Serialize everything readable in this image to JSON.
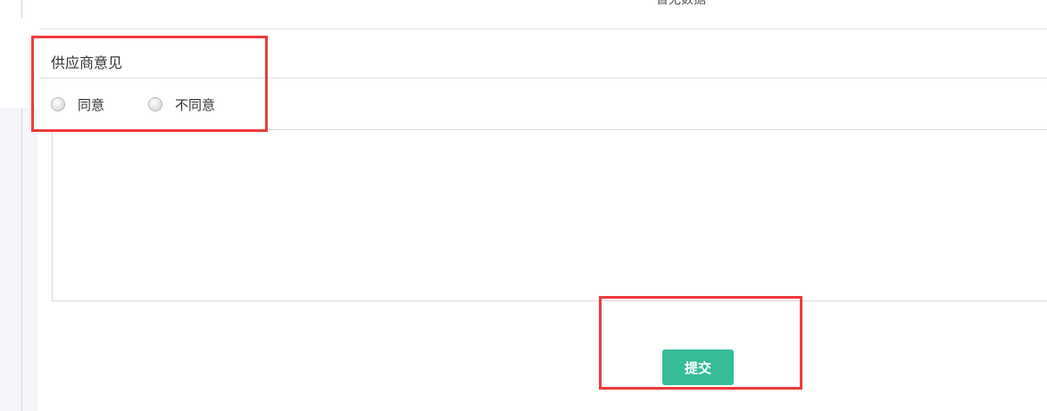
{
  "header": {
    "cut_off_text": "暂无数据"
  },
  "supplier_opinion": {
    "title": "供应商意见",
    "options": [
      {
        "label": "同意",
        "selected": false
      },
      {
        "label": "不同意",
        "selected": false
      }
    ]
  },
  "comment_field": {
    "value": ""
  },
  "actions": {
    "submit_label": "提交",
    "submit_color": "#36bc99"
  },
  "annotations": {
    "highlight_color": "#ef3b3b"
  }
}
